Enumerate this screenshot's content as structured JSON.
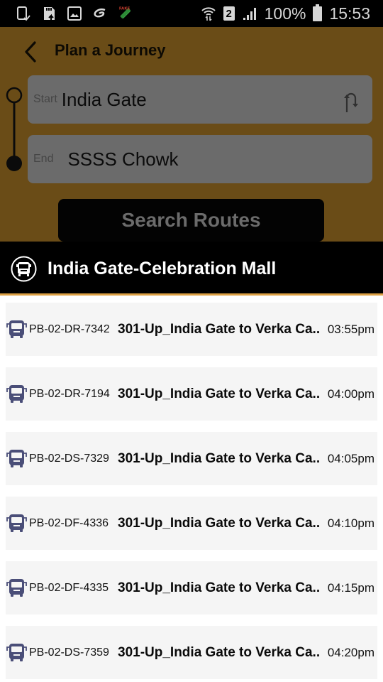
{
  "status_bar": {
    "left_icons": [
      "screenshot-icon",
      "sd-card-icon",
      "gallery-icon",
      "sync-icon",
      "fake-gps-icon"
    ],
    "sim_slot": "2",
    "battery_percent": "100%",
    "time": "15:53"
  },
  "header": {
    "title": "Plan a Journey"
  },
  "journey": {
    "start_label": "Start",
    "start_value": "India Gate",
    "end_label": "End",
    "end_value": "SSSS Chowk"
  },
  "search_button_label": "Search Routes",
  "result_header": {
    "title": "India Gate-Celebration Mall"
  },
  "buses": [
    {
      "reg": "PB-02-DR-7342",
      "route": "301-Up_India Gate to Verka Ca..",
      "time": "03:55pm"
    },
    {
      "reg": "PB-02-DR-7194",
      "route": "301-Up_India Gate to Verka Ca..",
      "time": "04:00pm"
    },
    {
      "reg": "PB-02-DS-7329",
      "route": "301-Up_India Gate to Verka Ca..",
      "time": "04:05pm"
    },
    {
      "reg": "PB-02-DF-4336",
      "route": "301-Up_India Gate to Verka Ca..",
      "time": "04:10pm"
    },
    {
      "reg": "PB-02-DF-4335",
      "route": "301-Up_India Gate to Verka Ca..",
      "time": "04:15pm"
    },
    {
      "reg": "PB-02-DS-7359",
      "route": "301-Up_India Gate to Verka Ca..",
      "time": "04:20pm"
    }
  ],
  "colors": {
    "panel_dimmed": "#6a4c17",
    "accent": "#dca044",
    "bus_icon": "#4a4e78"
  }
}
